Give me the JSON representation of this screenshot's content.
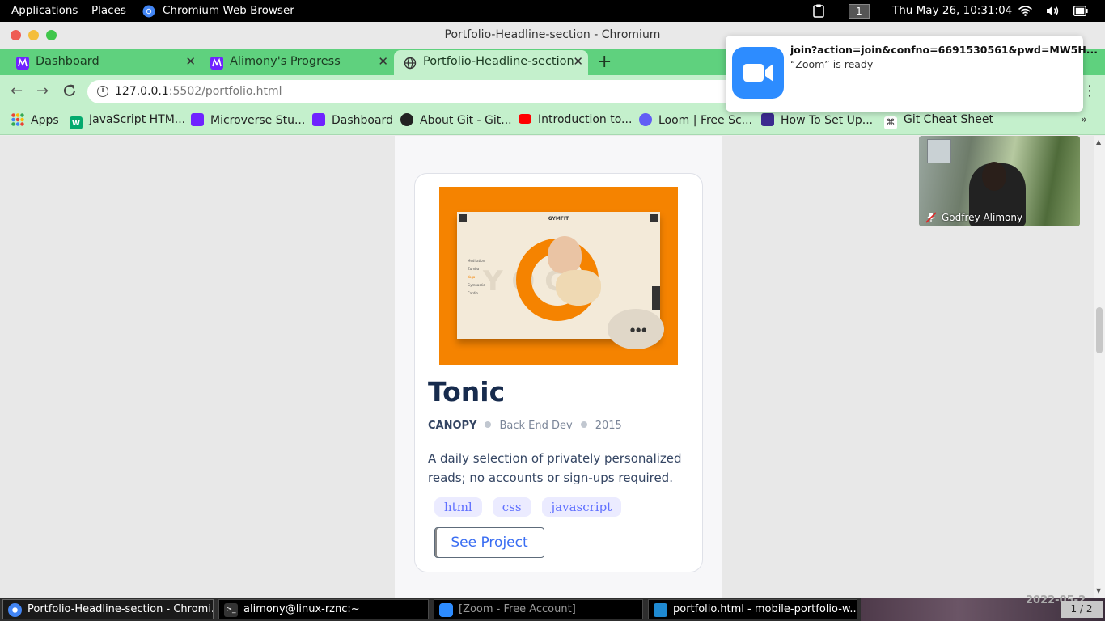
{
  "system_bar": {
    "applications": "Applications",
    "places": "Places",
    "active_app": "Chromium Web Browser",
    "workspace": "1",
    "datetime": "Thu May 26, 10:31:04"
  },
  "window": {
    "title": "Portfolio-Headline-section - Chromium"
  },
  "tabs": [
    {
      "label": "Dashboard"
    },
    {
      "label": "Alimony's Progress"
    },
    {
      "label": "Portfolio-Headline-section",
      "active": true
    }
  ],
  "address_bar": {
    "host": "127.0.0.1",
    "path": ":5502/portfolio.html"
  },
  "bookmarks": [
    {
      "label": "Apps"
    },
    {
      "label": "JavaScript HTM..."
    },
    {
      "label": "Microverse Stu..."
    },
    {
      "label": "Dashboard"
    },
    {
      "label": "About Git - Git..."
    },
    {
      "label": "Introduction to..."
    },
    {
      "label": "Loom | Free Sc..."
    },
    {
      "label": "How To Set Up..."
    },
    {
      "label": "Git Cheat Sheet"
    }
  ],
  "card": {
    "title": "Tonic",
    "client": "CANOPY",
    "role": "Back End Dev",
    "year": "2015",
    "description": "A daily selection of privately personalized reads; no accounts or sign-ups required.",
    "tags": [
      "html",
      "css",
      "javascript"
    ],
    "button": "See Project",
    "snapshot": {
      "brand": "GYMFIT",
      "bg_text": "YOGA",
      "menu": [
        "Meditation",
        "Zumba",
        "Yoga",
        "Gymnastic",
        "Cardio"
      ]
    }
  },
  "zoom": {
    "notification_title": "join?action=join&confno=6691530561&pwd=MW5H...",
    "notification_body": "“Zoom” is ready",
    "participant_name": "Godfrey Alimony"
  },
  "taskbar": [
    {
      "label": "Portfolio-Headline-section - Chromi..."
    },
    {
      "label": "alimony@linux-rznc:~"
    },
    {
      "label": "[Zoom - Free Account]"
    },
    {
      "label": "portfolio.html - mobile-portfolio-w..."
    }
  ],
  "taskbar_pager": "1 / 2",
  "taskbar_date_faint": "2022-05-2",
  "colors": {
    "tab_strip": "#5fd17e",
    "toolbar": "#c4f0cc",
    "snapshot_orange": "#f58300",
    "tag_text": "#6070ff",
    "button_text": "#396df2",
    "zoom_blue": "#2d8cff"
  }
}
